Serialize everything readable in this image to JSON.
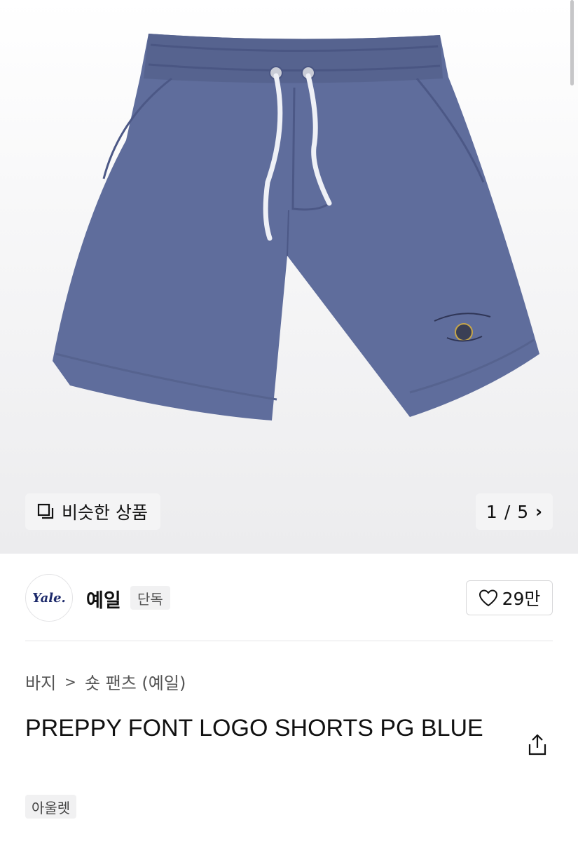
{
  "gallery": {
    "similar_label": "비슷한 상품",
    "current_page": "1",
    "page_separator": "/",
    "total_pages": "5",
    "image_alt": "product-photo-shorts"
  },
  "brand": {
    "logo_text": "Yale.",
    "name": "예일",
    "tag": "단독"
  },
  "like": {
    "count": "29만"
  },
  "breadcrumb": {
    "items": [
      "바지",
      "숏 팬츠 (예일)"
    ],
    "separator": ">"
  },
  "product": {
    "title": "PREPPY FONT LOGO SHORTS PG BLUE",
    "tag": "아울렛"
  },
  "colors": {
    "shorts": "#5f6d9c",
    "accent": "#1d2a6b"
  }
}
